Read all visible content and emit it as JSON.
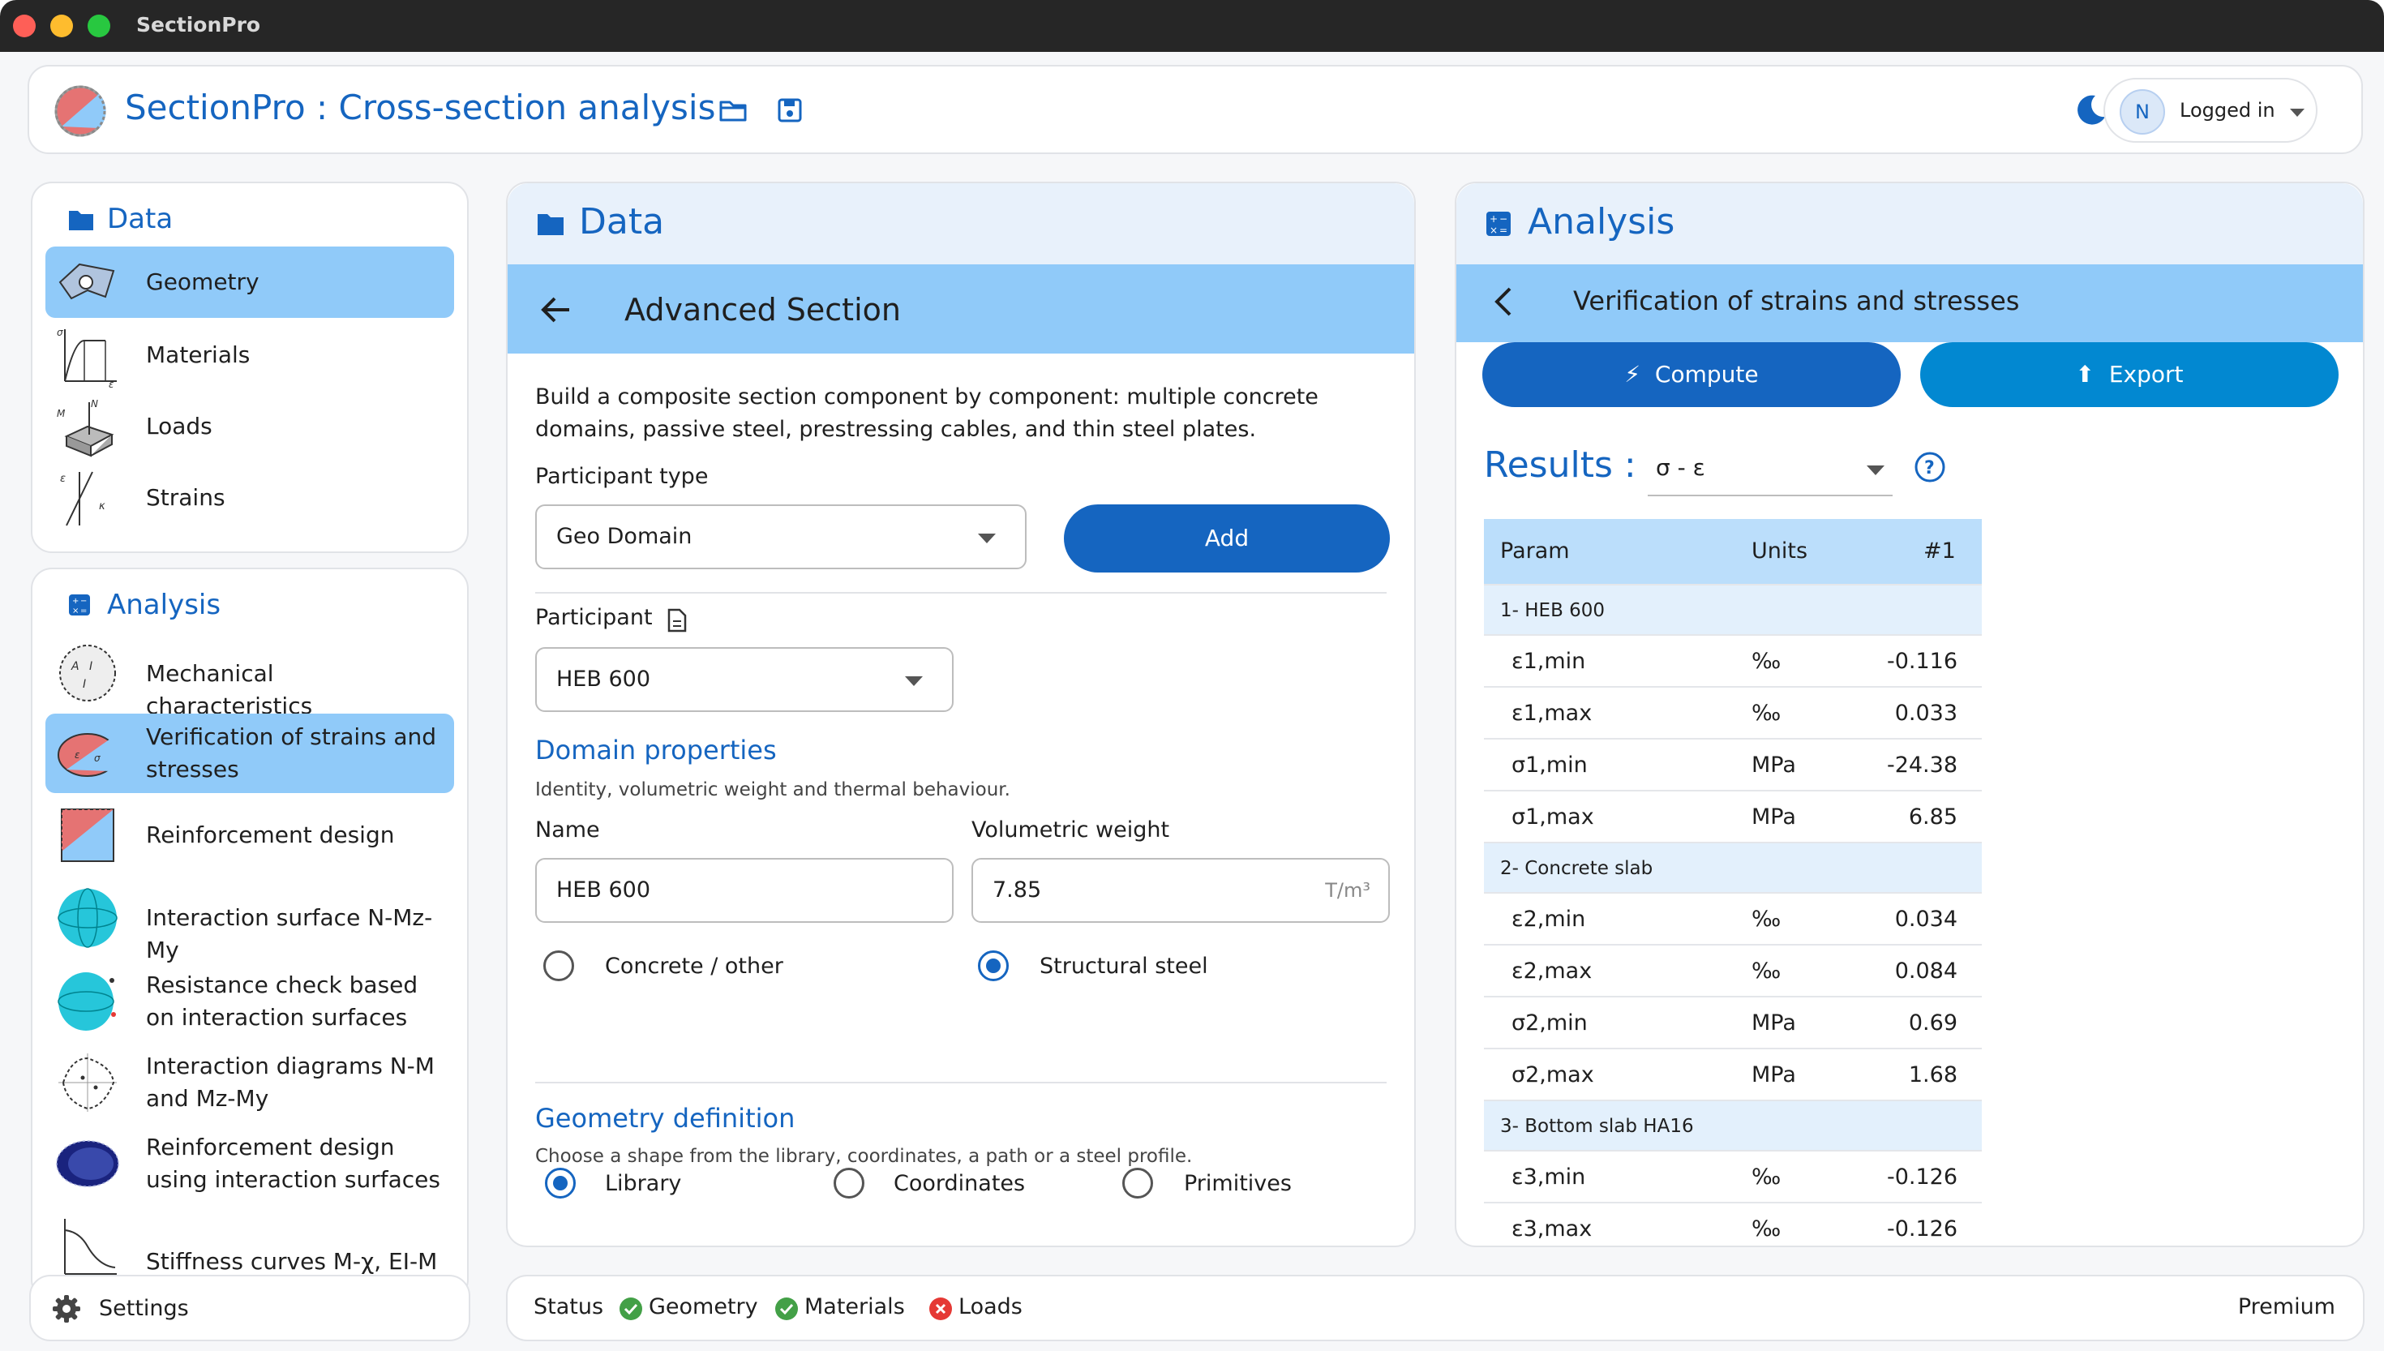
{
  "window": {
    "title": "SectionPro"
  },
  "header": {
    "title": "SectionPro : Cross-section analysis",
    "user": {
      "initial": "N",
      "label": "Logged in"
    }
  },
  "nav": {
    "data": {
      "title": "Data",
      "items": [
        {
          "label": "Geometry",
          "icon": "geometry-icon",
          "active": true
        },
        {
          "label": "Materials",
          "icon": "materials-icon"
        },
        {
          "label": "Loads",
          "icon": "loads-icon"
        },
        {
          "label": "Strains",
          "icon": "strains-icon"
        }
      ]
    },
    "analysis": {
      "title": "Analysis",
      "items": [
        {
          "label": "Mechanical characteristics",
          "icon": "mechanical-icon"
        },
        {
          "label": "Verification of strains and stresses",
          "icon": "verification-icon",
          "active": true
        },
        {
          "label": "Reinforcement design",
          "icon": "reinforcement-icon"
        },
        {
          "label": "Interaction surface N-Mz-My",
          "icon": "surface-icon"
        },
        {
          "label": "Resistance check based on interaction surfaces",
          "icon": "resistance-icon"
        },
        {
          "label": "Interaction diagrams N-M and Mz-My",
          "icon": "diagram-icon"
        },
        {
          "label": "Reinforcement design using interaction surfaces",
          "icon": "design-surface-icon"
        },
        {
          "label": "Stiffness curves M-χ, EI-M",
          "icon": "stiffness-icon"
        }
      ]
    }
  },
  "data_panel": {
    "title": "Data",
    "subtitle": "Advanced Section",
    "intro": "Build a composite section component by component: multiple concrete domains, passive steel, prestressing cables, and thin steel plates.",
    "participant_type": {
      "label": "Participant type",
      "value": "Geo Domain"
    },
    "add_button": "Add",
    "participant": {
      "label": "Participant",
      "value": "HEB 600"
    },
    "domain_properties": {
      "title": "Domain properties",
      "desc": "Identity, volumetric weight and thermal behaviour.",
      "name_label": "Name",
      "name_value": "HEB 600",
      "weight_label": "Volumetric weight",
      "weight_value": "7.85",
      "weight_unit": "T/m³",
      "material_options": [
        {
          "label": "Concrete / other",
          "selected": false
        },
        {
          "label": "Structural steel",
          "selected": true
        }
      ]
    },
    "geometry_definition": {
      "title": "Geometry definition",
      "desc": "Choose a shape from the library, coordinates, a path or a steel profile.",
      "options": [
        {
          "label": "Library",
          "selected": true
        },
        {
          "label": "Coordinates",
          "selected": false
        },
        {
          "label": "Primitives",
          "selected": false
        }
      ]
    }
  },
  "analysis_panel": {
    "title": "Analysis",
    "subtitle": "Verification of strains and stresses",
    "compute_button": "Compute",
    "export_button": "Export",
    "results_label": "Results :",
    "results_select": "σ - ε",
    "table": {
      "headers": [
        "Param",
        "Units",
        "#1"
      ],
      "groups": [
        {
          "name": "1- HEB 600",
          "rows": [
            {
              "param": "ε1,min",
              "unit": "‰",
              "value": "-0.116"
            },
            {
              "param": "ε1,max",
              "unit": "‰",
              "value": "0.033"
            },
            {
              "param": "σ1,min",
              "unit": "MPa",
              "value": "-24.38"
            },
            {
              "param": "σ1,max",
              "unit": "MPa",
              "value": "6.85"
            }
          ]
        },
        {
          "name": "2- Concrete slab",
          "rows": [
            {
              "param": "ε2,min",
              "unit": "‰",
              "value": "0.034"
            },
            {
              "param": "ε2,max",
              "unit": "‰",
              "value": "0.084"
            },
            {
              "param": "σ2,min",
              "unit": "MPa",
              "value": "0.69"
            },
            {
              "param": "σ2,max",
              "unit": "MPa",
              "value": "1.68"
            }
          ]
        },
        {
          "name": "3- Bottom slab HA16",
          "rows": [
            {
              "param": "ε3,min",
              "unit": "‰",
              "value": "-0.126"
            },
            {
              "param": "ε3,max",
              "unit": "‰",
              "value": "-0.126"
            }
          ]
        }
      ]
    }
  },
  "settings": {
    "label": "Settings"
  },
  "status": {
    "label": "Status",
    "items": [
      {
        "label": "Geometry",
        "ok": true
      },
      {
        "label": "Materials",
        "ok": true
      },
      {
        "label": "Loads",
        "ok": false
      }
    ],
    "plan": "Premium"
  },
  "colors": {
    "accent": "#1565c0",
    "active": "#90caf9",
    "panel_head": "#e8f1fb",
    "ok": "#43a047",
    "error": "#e53935"
  }
}
